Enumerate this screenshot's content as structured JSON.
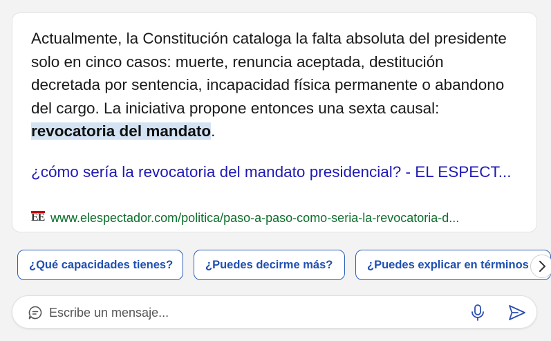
{
  "answer": {
    "text_before": "Actualmente, la Constitución cataloga la falta absoluta del presidente solo en cinco casos: muerte, renuncia aceptada, destitución decretada por sentencia, incapacidad física permanente o abandono del cargo. La iniciativa propone entonces una sexta causal: ",
    "highlight": "revocatoria del mandato",
    "text_after": "."
  },
  "source": {
    "title": "¿cómo sería la revocatoria del mandato presidencial? - EL ESPECT...",
    "favicon_text": "EE",
    "url": "www.elespectador.com/politica/paso-a-paso-como-seria-la-revocatoria-d..."
  },
  "suggestions": [
    {
      "label": "¿Qué capacidades tienes?"
    },
    {
      "label": "¿Puedes decirme más?"
    },
    {
      "label": "¿Puedes explicar en términos"
    }
  ],
  "input": {
    "placeholder": "Escribe un mensaje...",
    "value": ""
  },
  "icons": {
    "chat": "chat-bubble-icon",
    "mic": "microphone-icon",
    "send": "send-icon",
    "scroll": "chevron-right-icon"
  },
  "colors": {
    "link": "#1f1ab5",
    "url": "#0b6e2a",
    "chip_border": "#2b5fb7",
    "highlight_bg": "#d3e3f3"
  }
}
